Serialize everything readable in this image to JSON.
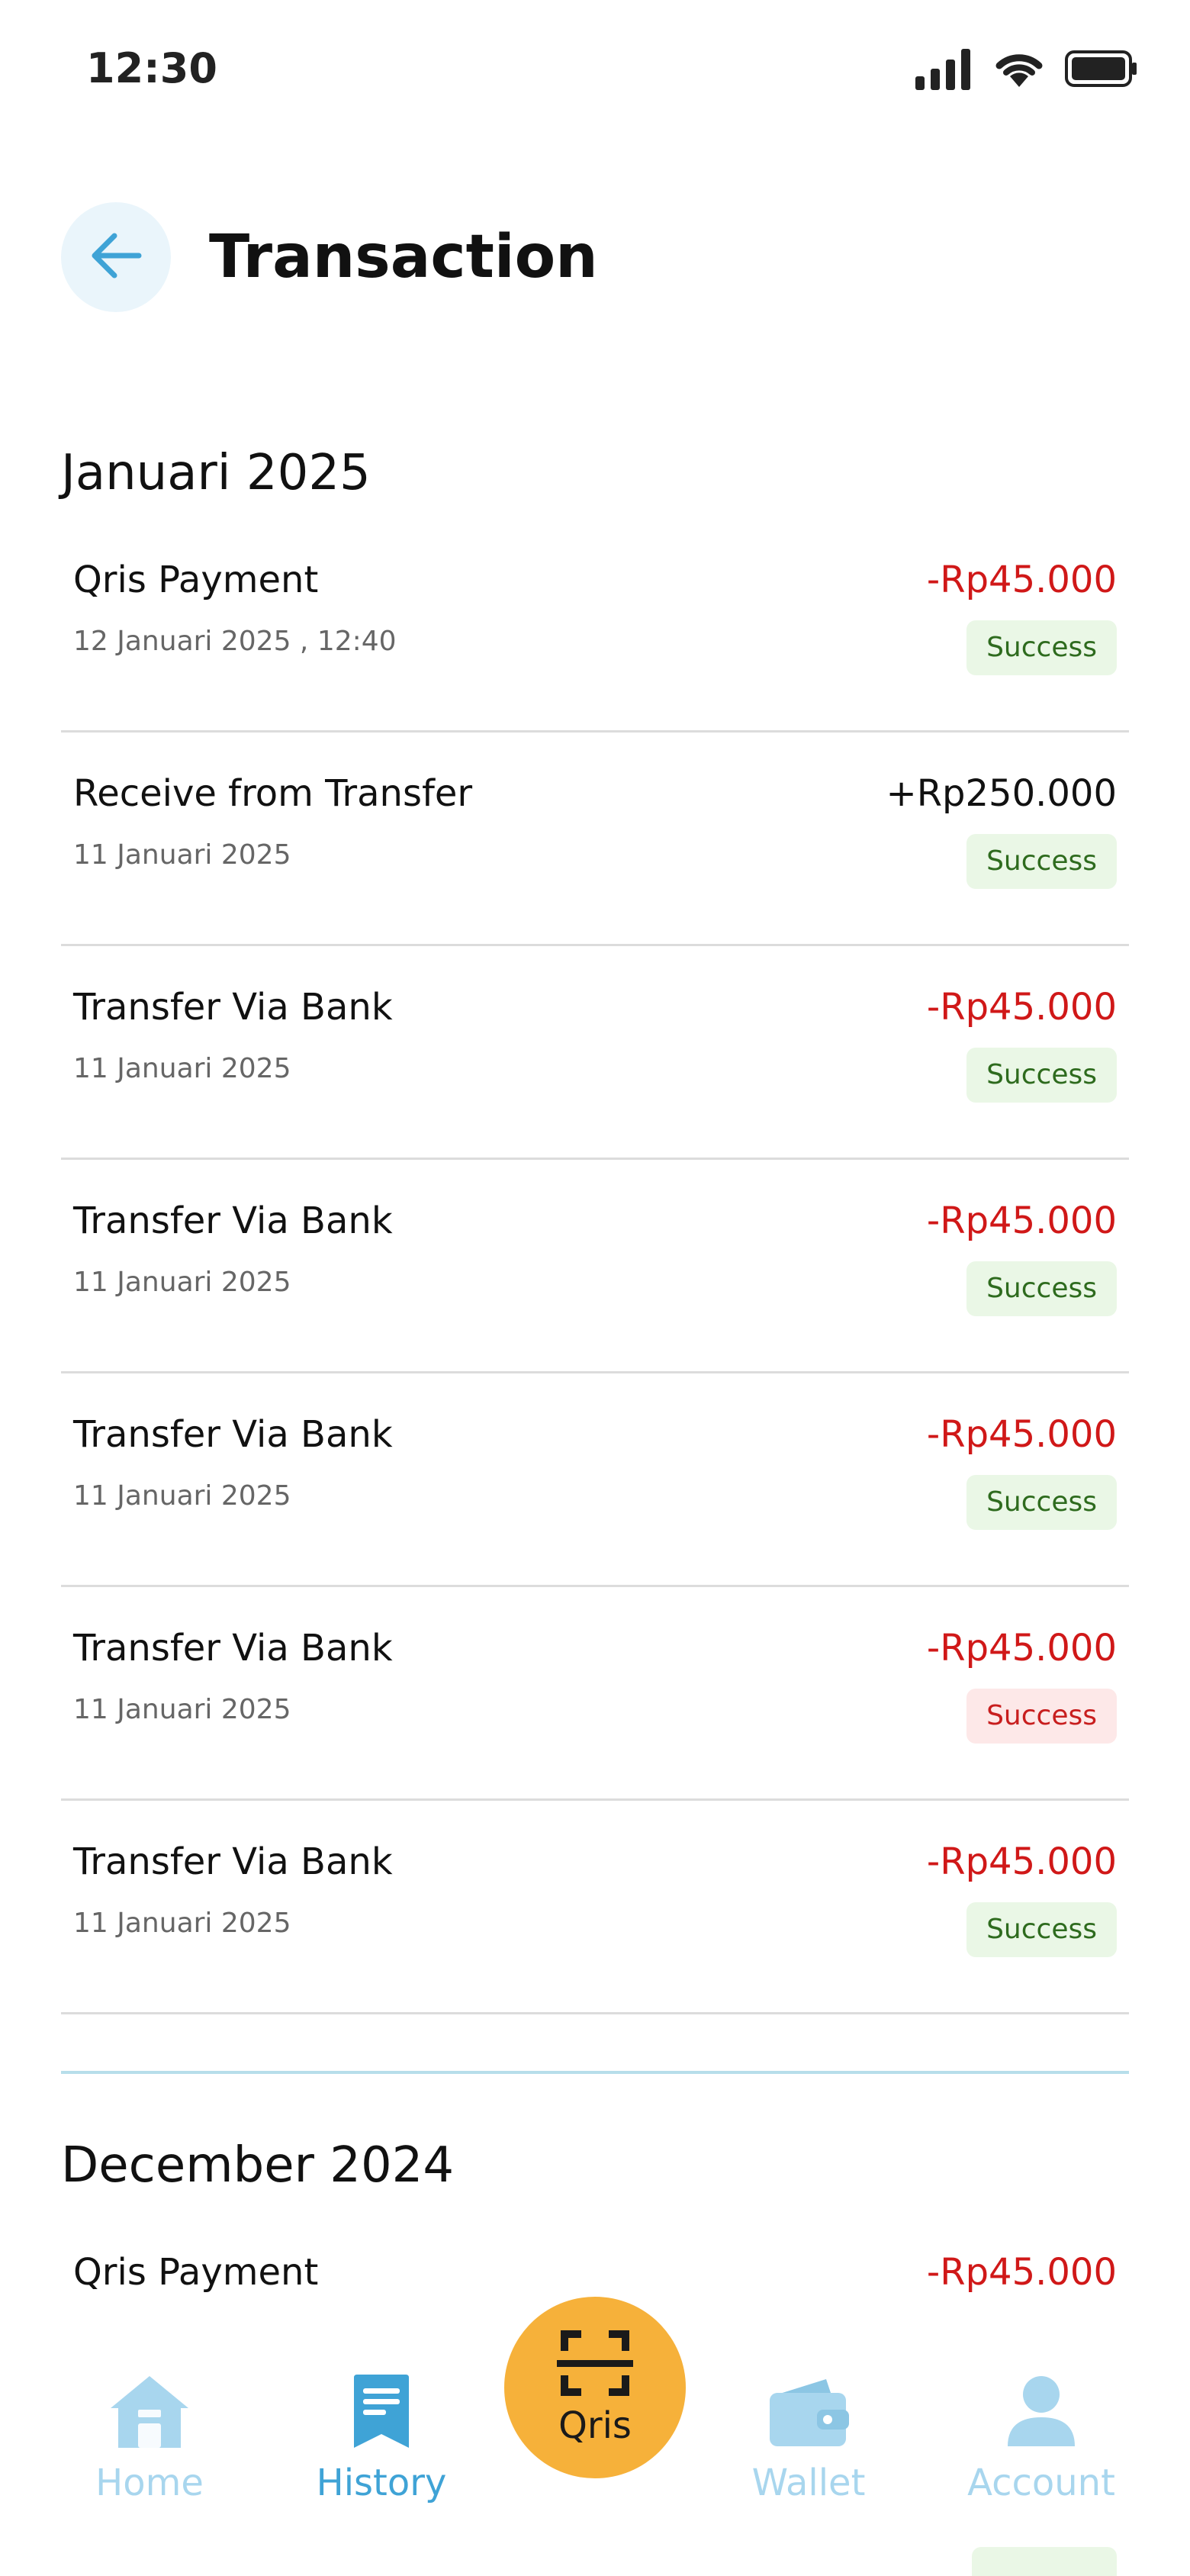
{
  "status": {
    "time": "12:30",
    "icons": [
      "signal-icon",
      "wifi-icon",
      "battery-icon"
    ]
  },
  "header": {
    "back_icon": "arrow-left-icon",
    "title": "Transaction"
  },
  "colors": {
    "accent": "#3FA3D6",
    "negative": "#D01818",
    "success_bg": "#EAF7E6",
    "success_text": "#2E6B1E",
    "fail_bg": "#FDE8E8",
    "fail_text": "#C81E1E",
    "qris": "#F6B13A"
  },
  "sections": [
    {
      "month": "Januari 2025",
      "transactions": [
        {
          "name": "Qris Payment",
          "date": "12 Januari 2025 , 12:40",
          "amount": "-Rp45.000",
          "status": "Success",
          "kind": "neg",
          "badge": "success"
        },
        {
          "name": "Receive from Transfer",
          "date": "11 Januari 2025",
          "amount": "+Rp250.000",
          "status": "Success",
          "kind": "pos",
          "badge": "success"
        },
        {
          "name": "Transfer Via Bank",
          "date": "11 Januari 2025",
          "amount": "-Rp45.000",
          "status": "Success",
          "kind": "neg",
          "badge": "success"
        },
        {
          "name": "Transfer Via Bank",
          "date": "11 Januari 2025",
          "amount": "-Rp45.000",
          "status": "Success",
          "kind": "neg",
          "badge": "success"
        },
        {
          "name": "Transfer Via Bank",
          "date": "11 Januari 2025",
          "amount": "-Rp45.000",
          "status": "Success",
          "kind": "neg",
          "badge": "success"
        },
        {
          "name": "Transfer Via Bank",
          "date": "11 Januari 2025",
          "amount": "-Rp45.000",
          "status": "Success",
          "kind": "neg",
          "badge": "fail"
        },
        {
          "name": "Transfer Via Bank",
          "date": "11 Januari 2025",
          "amount": "-Rp45.000",
          "status": "Success",
          "kind": "neg",
          "badge": "success"
        }
      ]
    },
    {
      "month": "December 2024",
      "transactions": [
        {
          "name": "Qris Payment",
          "amount": "-Rp45.000",
          "kind": "neg"
        }
      ]
    }
  ],
  "nav": {
    "home": {
      "label": "Home",
      "icon": "home-icon"
    },
    "history": {
      "label": "History",
      "icon": "history-icon",
      "active": true
    },
    "qris": {
      "label": "Qris",
      "icon": "scan-icon"
    },
    "wallet": {
      "label": "Wallet",
      "icon": "wallet-icon"
    },
    "account": {
      "label": "Account",
      "icon": "account-icon"
    }
  }
}
